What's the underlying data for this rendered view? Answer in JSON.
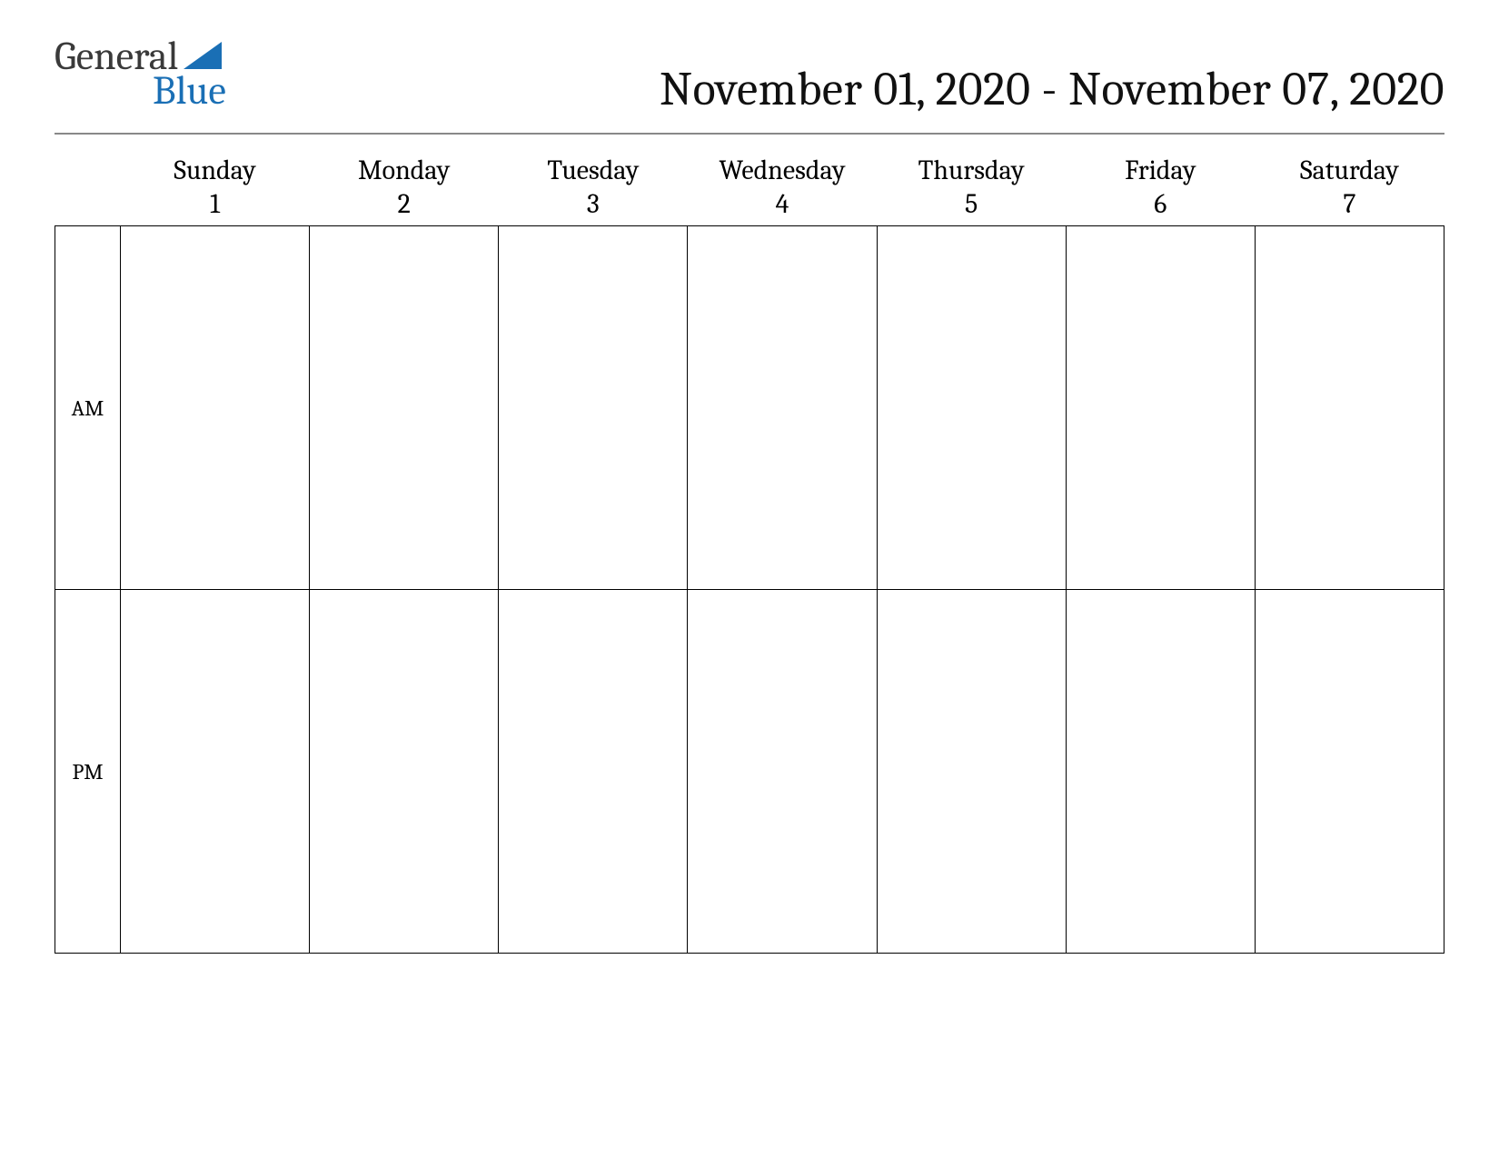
{
  "logo": {
    "word1": "General",
    "word2": "Blue",
    "triangle_color": "#1a6fb5"
  },
  "title": "November 01, 2020 - November 07, 2020",
  "days": [
    {
      "name": "Sunday",
      "num": "1"
    },
    {
      "name": "Monday",
      "num": "2"
    },
    {
      "name": "Tuesday",
      "num": "3"
    },
    {
      "name": "Wednesday",
      "num": "4"
    },
    {
      "name": "Thursday",
      "num": "5"
    },
    {
      "name": "Friday",
      "num": "6"
    },
    {
      "name": "Saturday",
      "num": "7"
    }
  ],
  "periods": {
    "am": "AM",
    "pm": "PM"
  }
}
